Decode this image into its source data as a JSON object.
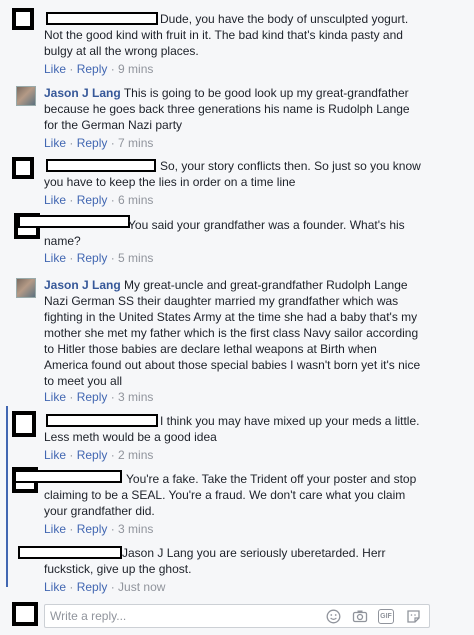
{
  "comments": [
    {
      "lines": [
        "Dude, you have the body of unsculpted yogurt.",
        "Not the good kind with fruit in it. The bad kind that's kinda pasty and",
        "bulgy at all the wrong places."
      ],
      "like": "Like",
      "reply": "Reply",
      "time": "9 mins"
    },
    {
      "author": "Jason J Lang",
      "lines": [
        "This is going to be good look up my great-grandfather",
        "because he goes back three generations his name is Rudolph Lange",
        "for the German Nazi party"
      ],
      "like": "Like",
      "reply": "Reply",
      "time": "7 mins"
    },
    {
      "lines": [
        "So, your story conflicts then. So just so you know",
        "you have to keep the lies in order on a time line"
      ],
      "like": "Like",
      "reply": "Reply",
      "time": "6 mins"
    },
    {
      "lines": [
        "You said your grandfather was a founder. What's his",
        "name?"
      ],
      "like": "Like",
      "reply": "Reply",
      "time": "5 mins"
    },
    {
      "author": "Jason J Lang",
      "lines": [
        "My great-uncle and great-grandfather Rudolph Lange",
        "Nazi German SS their daughter married my grandfather which was",
        "fighting in the United States Army at the time she had a baby that's my",
        "mother she met my father which is the first class Navy sailor according",
        "to Hitler those babies are declare lethal weapons at Birth when",
        "America found out about those special babies I wasn't born yet it's nice",
        "to meet you all"
      ],
      "like": "Like",
      "reply": "Reply",
      "time": "3 mins"
    },
    {
      "lines": [
        "I think you may have mixed up your meds a little.",
        "Less meth would be a good idea"
      ],
      "like": "Like",
      "reply": "Reply",
      "time": "2 mins"
    },
    {
      "lines": [
        "You're a fake. Take the Trident off your poster and stop",
        "claiming to be a SEAL. You're a fraud. We don't care what you claim",
        "your grandfather did."
      ],
      "like": "Like",
      "reply": "Reply",
      "time": "3 mins"
    },
    {
      "lines": [
        "Jason J Lang you are seriously uberetarded. Herr",
        "fuckstick, give up the ghost."
      ],
      "like": "Like",
      "reply": "Reply",
      "time": "Just now"
    }
  ],
  "reply_box": {
    "placeholder": "Write a reply..."
  },
  "icons": [
    "emoji-icon",
    "camera-icon",
    "gif-icon",
    "sticker-icon"
  ],
  "colors": {
    "link": "#4267b2",
    "author": "#365899",
    "meta": "#90949c",
    "thread_line": "#4267b2"
  }
}
